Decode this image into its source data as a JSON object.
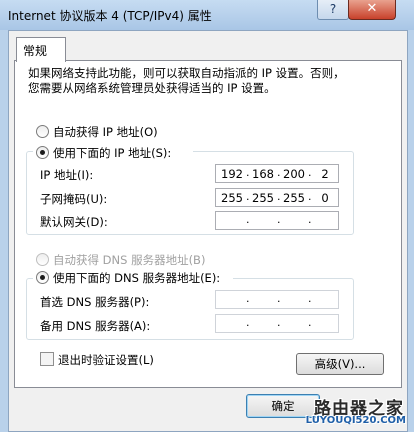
{
  "window": {
    "title": "Internet 协议版本 4 (TCP/IPv4) 属性",
    "help_glyph": "?",
    "close_glyph": "✕"
  },
  "tab": {
    "label": "常规"
  },
  "description": {
    "line1": "如果网络支持此功能，则可以获取自动指派的 IP 设置。否则，",
    "line2": "您需要从网络系统管理员处获得适当的 IP 设置。"
  },
  "ip": {
    "auto_label": "自动获得 IP 地址(O)",
    "auto_selected": false,
    "manual_label": "使用下面的 IP 地址(S):",
    "manual_selected": true,
    "address_label": "IP 地址(I):",
    "address": [
      "192",
      "168",
      "200",
      "2"
    ],
    "subnet_label": "子网掩码(U):",
    "subnet": [
      "255",
      "255",
      "255",
      "0"
    ],
    "gateway_label": "默认网关(D):",
    "gateway": [
      "",
      "",
      "",
      ""
    ]
  },
  "dns": {
    "auto_label": "自动获得 DNS 服务器地址(B)",
    "auto_selected": false,
    "manual_label": "使用下面的 DNS 服务器地址(E):",
    "manual_selected": true,
    "preferred_label": "首选 DNS 服务器(P):",
    "preferred": [
      "",
      "",
      "",
      ""
    ],
    "alternate_label": "备用 DNS 服务器(A):",
    "alternate": [
      "",
      "",
      "",
      ""
    ]
  },
  "validate": {
    "label": "退出时验证设置(L)",
    "checked": false
  },
  "buttons": {
    "advanced": "高级(V)...",
    "ok": "确定"
  },
  "watermark": {
    "brand": "路由器之家",
    "url": "LUYOUQI520.COM"
  }
}
